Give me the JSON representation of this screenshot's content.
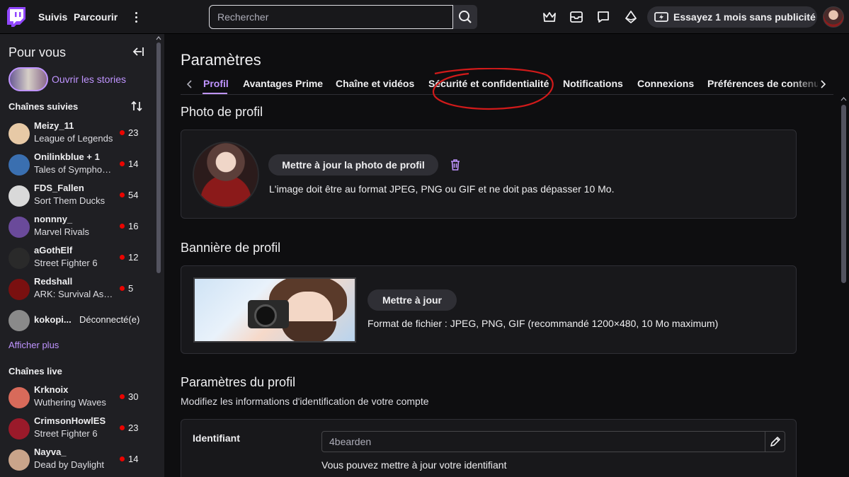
{
  "topnav": {
    "following": "Suivis",
    "browse": "Parcourir",
    "search_placeholder": "Rechercher",
    "promo": "Essayez 1 mois sans publicité"
  },
  "sidebar": {
    "title": "Pour vous",
    "stories": "Ouvrir les stories",
    "followed_title": "Chaînes suivies",
    "followed": [
      {
        "name": "Meizy_11",
        "game": "League of Legends",
        "viewers": "23",
        "color": "#e7c9a6"
      },
      {
        "name": "Onilinkblue + 1",
        "game": "Tales of Symphonia",
        "viewers": "14",
        "color": "#3a6fb0"
      },
      {
        "name": "FDS_Fallen",
        "game": "Sort Them Ducks",
        "viewers": "54",
        "color": "#d9d9d9"
      },
      {
        "name": "nonnny_",
        "game": "Marvel Rivals",
        "viewers": "16",
        "color": "#6a4a9a"
      },
      {
        "name": "aGothElf",
        "game": "Street Fighter 6",
        "viewers": "12",
        "color": "#2a2a2a"
      },
      {
        "name": "Redshall",
        "game": "ARK: Survival Ascended",
        "viewers": "5",
        "color": "#7a1010"
      }
    ],
    "offline": {
      "name": "kokopi...",
      "status": "Déconnecté(e)",
      "color": "#8a8a8a"
    },
    "show_more": "Afficher plus",
    "live_title": "Chaînes live",
    "live": [
      {
        "name": "Krknoix",
        "game": "Wuthering Waves",
        "viewers": "30",
        "color": "#d86a5a"
      },
      {
        "name": "CrimsonHowlES",
        "game": "Street Fighter 6",
        "viewers": "23",
        "color": "#9a1a2a"
      },
      {
        "name": "Nayva_",
        "game": "Dead by Daylight",
        "viewers": "14",
        "color": "#c9a48a"
      }
    ]
  },
  "main": {
    "title": "Paramètres",
    "tabs": [
      "Profil",
      "Avantages Prime",
      "Chaîne et vidéos",
      "Sécurité et confidentialité",
      "Notifications",
      "Connexions",
      "Préférences de contenu"
    ],
    "photo": {
      "title": "Photo de profil",
      "button": "Mettre à jour la photo de profil",
      "hint": "L'image doit être au format JPEG, PNG ou GIF et ne doit pas dépasser 10 Mo."
    },
    "banner": {
      "title": "Bannière de profil",
      "button": "Mettre à jour",
      "hint": "Format de fichier : JPEG, PNG, GIF (recommandé 1200×480, 10 Mo maximum)"
    },
    "profile_settings": {
      "title": "Paramètres du profil",
      "subtitle": "Modifiez les informations d'identification de votre compte",
      "username_label": "Identifiant",
      "username_value": "4bearden",
      "username_hint": "Vous pouvez mettre à jour votre identifiant"
    }
  }
}
